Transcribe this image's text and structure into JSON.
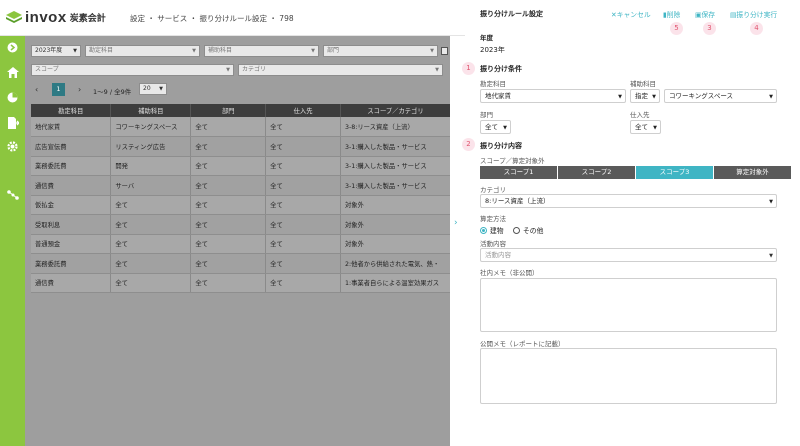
{
  "app": {
    "logo_text": "invox",
    "logo_sub": "炭素会計"
  },
  "breadcrumb": "設定 ・ サービス ・ 振り分けルール設定 ・ 798",
  "filters": {
    "year": "2023年度",
    "account_ph": "勘定科目",
    "sub_account_ph": "補助科目",
    "dept_ph": "部門",
    "scope_ph": "スコープ",
    "category_ph": "カテゴリ"
  },
  "pagination": {
    "page": "1",
    "range": "1〜9 / 全9件",
    "per_page": "20"
  },
  "table": {
    "headers": [
      "勘定科目",
      "補助科目",
      "部門",
      "仕入先",
      "スコープ／カテゴリ"
    ],
    "rows": [
      [
        "地代家賃",
        "コワーキングスペース",
        "全て",
        "全て",
        "3-8:リース資産（上流）"
      ],
      [
        "広告宣伝費",
        "リスティング広告",
        "全て",
        "全て",
        "3-1:購入した製品・サービス"
      ],
      [
        "業務委託費",
        "開発",
        "全て",
        "全て",
        "3-1:購入した製品・サービス"
      ],
      [
        "通信費",
        "サーバ",
        "全て",
        "全て",
        "3-1:購入した製品・サービス"
      ],
      [
        "仮払金",
        "全て",
        "全て",
        "全て",
        "対象外"
      ],
      [
        "受取利息",
        "全て",
        "全て",
        "全て",
        "対象外"
      ],
      [
        "普通預金",
        "全て",
        "全て",
        "全て",
        "対象外"
      ],
      [
        "業務委託費",
        "全て",
        "全て",
        "全て",
        "2:他者から供給された電気、熱・"
      ],
      [
        "通信費",
        "全て",
        "全て",
        "全て",
        "1:事業者自らによる温室効果ガス"
      ]
    ]
  },
  "panel": {
    "title": "振り分けルール設定",
    "cancel": "キャンセル",
    "delete": "削除",
    "save": "保存",
    "execute": "振り分け実行",
    "markers": [
      "1",
      "2",
      "3",
      "4",
      "5"
    ],
    "year_label": "年度",
    "year_value": "2023年",
    "cond_title": "振り分け条件",
    "account_label": "勘定科目",
    "account_value": "地代家賃",
    "sub_label": "補助科目",
    "sub_mode": "指定",
    "sub_value": "コワーキングスペース",
    "dept_label": "部門",
    "dept_value": "全て",
    "supplier_label": "仕入先",
    "supplier_value": "全て",
    "content_title": "振り分け内容",
    "scope_label": "スコープ／算定対象外",
    "tabs": [
      "スコープ1",
      "スコープ2",
      "スコープ3",
      "算定対象外"
    ],
    "category_label": "カテゴリ",
    "category_value": "8:リース資産（上流）",
    "method_label": "算定方法",
    "method_opt1": "建物",
    "method_opt2": "その他",
    "activity_label": "活動内容",
    "activity_ph": "活動内容",
    "memo_internal_label": "社内メモ（非公開）",
    "memo_public_label": "公開メモ（レポートに記載）"
  },
  "colors": {
    "accent": "#3fb5c4",
    "sidebar": "#8cc63f",
    "marker": "#e0556f"
  }
}
